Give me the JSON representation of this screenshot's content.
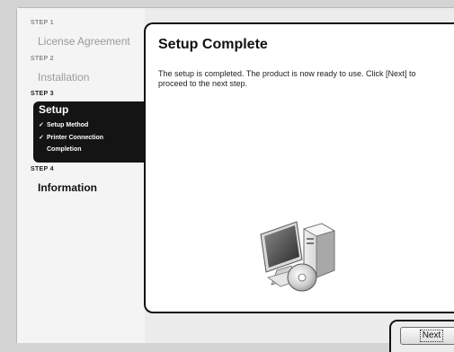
{
  "sidebar": {
    "steps": [
      {
        "label": "STEP 1",
        "title": "License Agreement"
      },
      {
        "label": "STEP 2",
        "title": "Installation"
      },
      {
        "label": "STEP 3",
        "title": "Setup"
      },
      {
        "label": "STEP 4",
        "title": "Information"
      }
    ],
    "substeps": [
      {
        "check": "✓",
        "label": "Setup Method"
      },
      {
        "check": "✓",
        "label": "Printer Connection"
      },
      {
        "check": "",
        "label": "Completion"
      }
    ]
  },
  "panel": {
    "title": "Setup Complete",
    "message": "The setup is completed. The product is now ready to use. Click [Next] to proceed to the next step."
  },
  "buttons": {
    "next": "Next"
  },
  "icons": {
    "illustration": "computer-with-cd-icon"
  }
}
